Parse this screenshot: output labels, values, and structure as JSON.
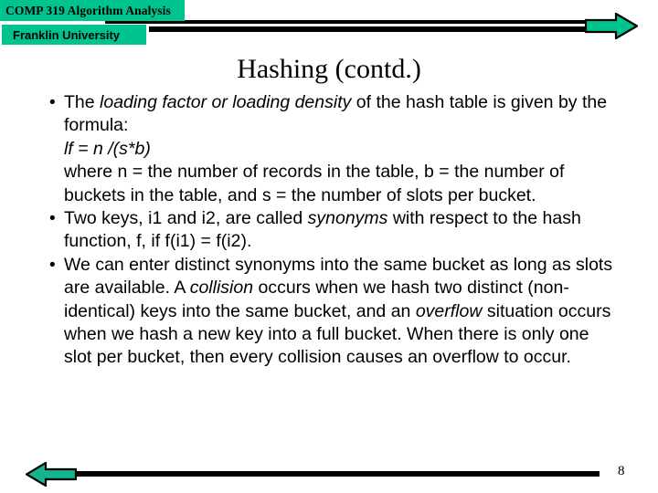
{
  "header": {
    "course_label": "COMP 319  Algorithm Analysis",
    "university_label": "Franklin University",
    "arrow_right_icon": "right-arrow-icon"
  },
  "slide": {
    "title": "Hashing (contd.)",
    "bullets": [
      {
        "marker": "•",
        "lines": [
          [
            {
              "t": "The ",
              "i": false
            },
            {
              "t": "loading factor or loading density",
              "i": true
            },
            {
              "t": " of the hash table is given by the formula:",
              "i": false
            }
          ],
          [
            {
              "t": "lf = n /(s*b)",
              "i": true
            }
          ],
          [
            {
              "t": "where n = the number of records in the table,  b = the number of buckets in the table, and s = the number of slots per bucket.",
              "i": false
            }
          ]
        ]
      },
      {
        "marker": "•",
        "lines": [
          [
            {
              "t": "Two keys, i1 and i2, are called ",
              "i": false
            },
            {
              "t": "synonyms",
              "i": true
            },
            {
              "t": " with respect to the hash function, f, if f(i1) = f(i2).",
              "i": false
            }
          ]
        ]
      },
      {
        "marker": "•",
        "lines": [
          [
            {
              "t": " We can enter distinct synonyms into the same bucket as long as slots are available. A ",
              "i": false
            },
            {
              "t": "collision",
              "i": true
            },
            {
              "t": " occurs when we hash two distinct (non-identical) keys into the same bucket, and an ",
              "i": false
            },
            {
              "t": "overflow",
              "i": true
            },
            {
              "t": " situation occurs when we hash a new key into a full bucket. When there is only one slot per bucket, then every collision causes an overflow to occur.",
              "i": false
            }
          ]
        ]
      }
    ]
  },
  "footer": {
    "arrow_left_icon": "left-arrow-icon",
    "page_number": "8"
  },
  "colors": {
    "accent_green": "#00c490",
    "rule_black": "#000000",
    "text_black": "#000000",
    "background": "#ffffff"
  }
}
